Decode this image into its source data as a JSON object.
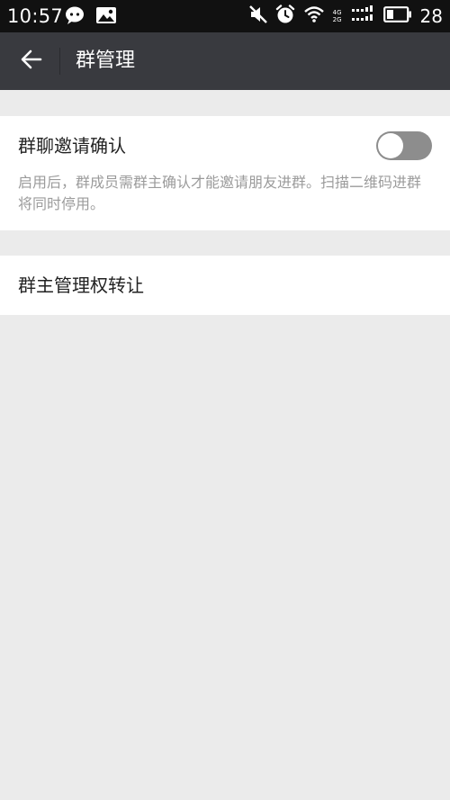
{
  "status_bar": {
    "time": "10:57",
    "battery_level": "28",
    "network_4g": "4G",
    "network_2g": "2G",
    "icons": [
      "wechat-icon",
      "image-icon",
      "mute-icon",
      "alarm-icon",
      "wifi-icon",
      "signal-icon",
      "battery-icon"
    ]
  },
  "header": {
    "title": "群管理",
    "back_icon": "back-arrow-icon"
  },
  "settings": {
    "invite_confirm": {
      "title": "群聊邀请确认",
      "description": "启用后，群成员需群主确认才能邀请朋友进群。扫描二维码进群将同时停用。",
      "enabled": false
    },
    "transfer_owner": {
      "title": "群主管理权转让"
    }
  },
  "colors": {
    "app_bar": "#393a3f",
    "status_bar": "#111111",
    "background": "#ebebeb",
    "toggle_off": "#8d8d8d"
  }
}
